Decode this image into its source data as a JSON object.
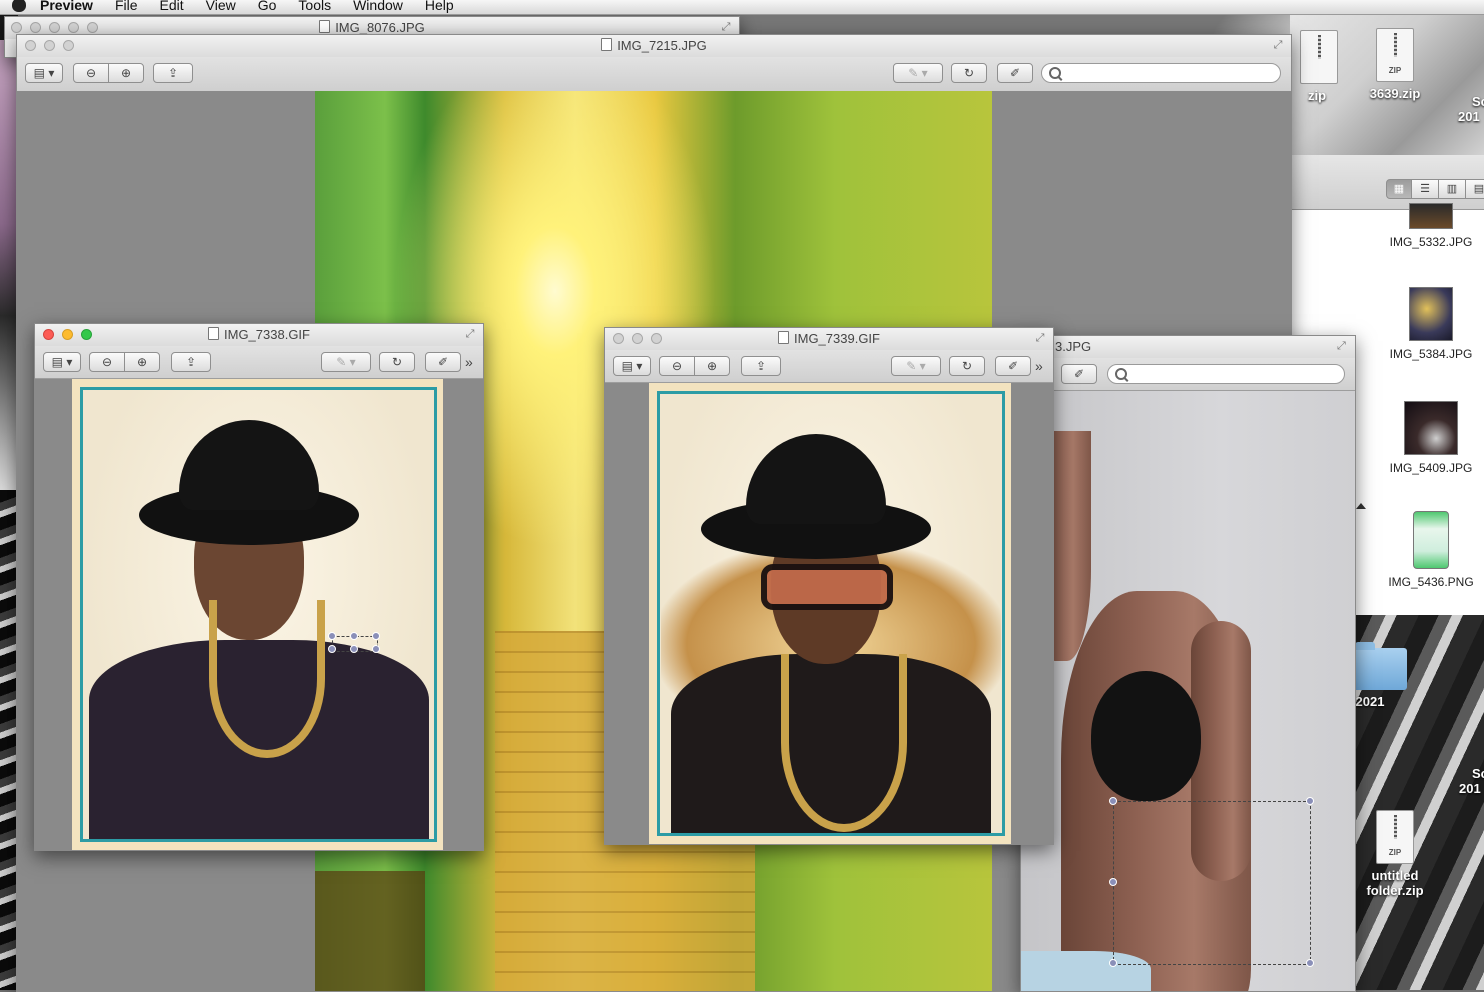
{
  "menubar": {
    "app": "Preview",
    "items": [
      "File",
      "Edit",
      "View",
      "Go",
      "Tools",
      "Window",
      "Help"
    ]
  },
  "windows": {
    "back": {
      "title": "IMG_8076.JPG"
    },
    "main": {
      "title": "IMG_7215.JPG"
    },
    "left": {
      "title": "IMG_7338.GIF"
    },
    "middle": {
      "title": "IMG_7339.GIF"
    },
    "right": {
      "title_fragment": "3.JPG"
    }
  },
  "toolbar": {
    "sidebar_icon": "sidebar-icon",
    "zoom_out_icon": "zoom-out-icon",
    "zoom_in_icon": "zoom-in-icon",
    "share_icon": "share-icon",
    "annotate_icon": "pen-icon",
    "rotate_icon": "rotate-icon",
    "edit_icon": "edit-icon",
    "overflow": "»"
  },
  "finder": {
    "items": [
      "IMG_5332.JPG",
      "IMG_5384.JPG",
      "IMG_5409.JPG",
      "IMG_5436.PNG"
    ]
  },
  "desktop": {
    "icons": {
      "zip_partial": "zip",
      "zip_3639": "3639.zip",
      "sc_partial_1_line1": "Sc",
      "sc_partial_1_line2": "201",
      "folder_2021": "2021",
      "sc_partial_2_line1": "Sc",
      "sc_partial_2_line2": "201",
      "untitled_line1": "untitled",
      "untitled_line2": "folder.zip"
    },
    "zip_label": "ZIP"
  },
  "colors": {
    "close": "#fc5c55",
    "minimize": "#fdbb2e",
    "zoom": "#33c84a",
    "card_border": "#2c9ca5"
  }
}
